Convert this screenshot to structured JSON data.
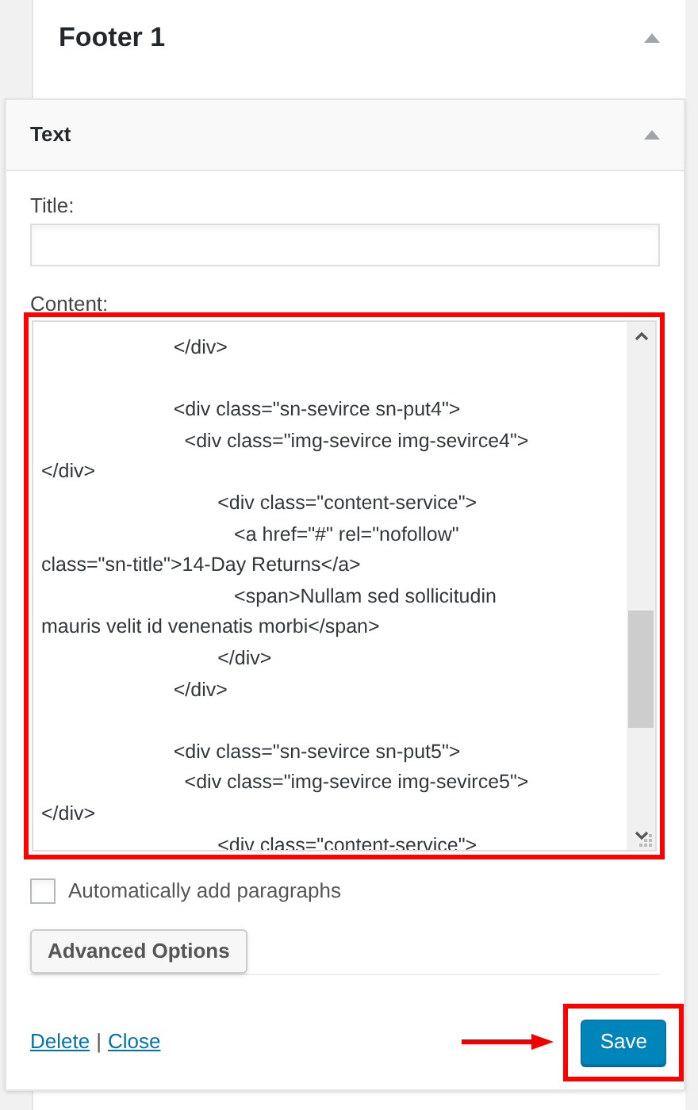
{
  "sidebar": {
    "title": "Footer 1",
    "expanded": true
  },
  "widget": {
    "title": "Text",
    "expanded": true,
    "title_label": "Title:",
    "content_label": "Content:",
    "content_blocks": [
      [
        "                        </div>"
      ],
      [
        "                        <div class=\"sn-sevirce sn-put4\">",
        "                          <div class=\"img-sevirce img-sevirce4\">",
        "</div>",
        "                                <div class=\"content-service\">",
        "                                   <a href=\"#\" rel=\"nofollow\"",
        "class=\"sn-title\">14-Day Returns</a>",
        "                                   <span>Nullam sed sollicitudin",
        "mauris velit id venenatis morbi</span>",
        "                                </div>",
        "                        </div>"
      ],
      [
        "                        <div class=\"sn-sevirce sn-put5\">",
        "                          <div class=\"img-sevirce img-sevirce5\">",
        "</div>",
        "                                <div class=\"content-service\">"
      ]
    ],
    "auto_paragraphs": {
      "label": "Automatically add paragraphs",
      "checked": false
    },
    "advanced_button": "Advanced Options",
    "links": [
      "Delete",
      "Close"
    ],
    "separator": "|",
    "save_button": "Save"
  }
}
